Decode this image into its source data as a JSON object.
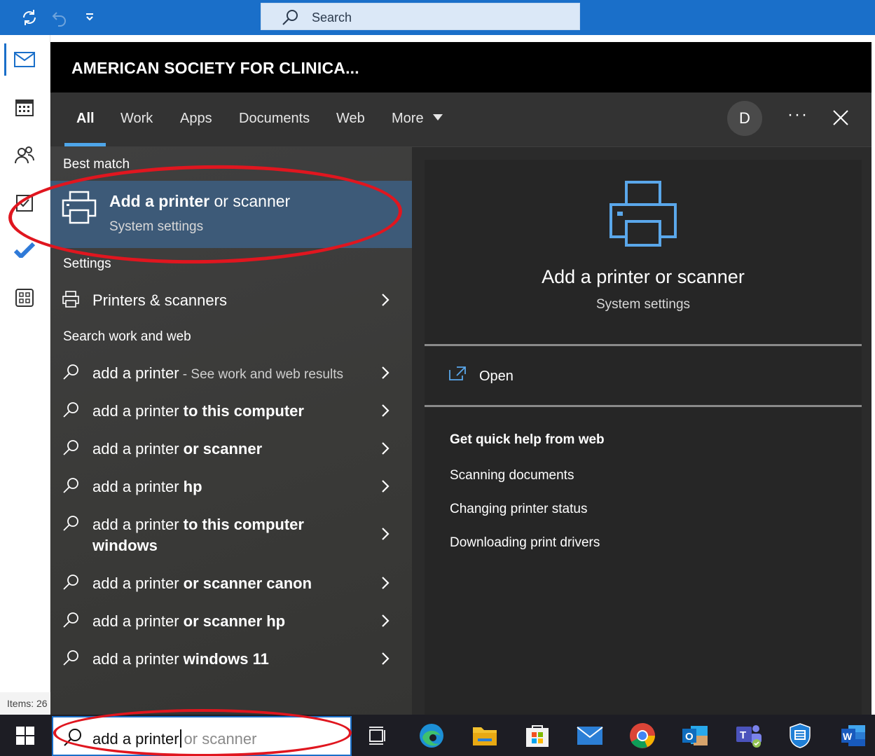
{
  "outlook": {
    "search_placeholder": "Search",
    "status_items": "Items: 26",
    "accent": "#1a6fc9"
  },
  "flyout": {
    "org_name": "AMERICAN SOCIETY FOR CLINICA...",
    "tabs": [
      {
        "label": "All",
        "active": true
      },
      {
        "label": "Work"
      },
      {
        "label": "Apps"
      },
      {
        "label": "Documents"
      },
      {
        "label": "Web"
      },
      {
        "label": "More"
      }
    ],
    "avatar_initial": "D",
    "more_options": "···",
    "best_match": {
      "heading": "Best match",
      "title_bold": "Add a printer",
      "title_rest": " or scanner",
      "subtitle": "System settings"
    },
    "settings": {
      "heading": "Settings",
      "item": "Printers & scanners"
    },
    "search_web": {
      "heading": "Search work and web",
      "first": {
        "query": "add a printer",
        "suffix": " - See work and web results"
      },
      "items": [
        {
          "typed": "add a printer",
          "rest": " to this computer"
        },
        {
          "typed": "add a printer",
          "rest": " or scanner"
        },
        {
          "typed": "add a printer",
          "rest": " hp"
        },
        {
          "typed": "add a printer",
          "rest": " to this computer",
          "rest2": "windows"
        },
        {
          "typed": "add a printer",
          "rest": " or scanner canon"
        },
        {
          "typed": "add a printer",
          "rest": " or scanner hp"
        },
        {
          "typed": "add a printer",
          "rest": " windows 11"
        }
      ]
    },
    "preview": {
      "title": "Add a printer or scanner",
      "subtitle": "System settings",
      "open_label": "Open",
      "help_heading": "Get quick help from web",
      "help_links": [
        "Scanning documents",
        "Changing printer status",
        "Downloading print drivers"
      ]
    }
  },
  "taskbar": {
    "typed_text": "add a printer",
    "suggestion_text": "or scanner"
  }
}
